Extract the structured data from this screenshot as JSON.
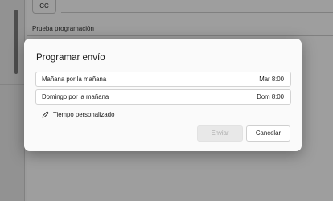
{
  "background": {
    "cc_label": "CC",
    "subject_text": "Prueba programación"
  },
  "dialog": {
    "title": "Programar envío",
    "options": [
      {
        "label": "Mañana por la mañana",
        "time": "Mar 8:00"
      },
      {
        "label": "Domingo por la mañana",
        "time": "Dom 8:00"
      }
    ],
    "custom_time_label": "Tiempo personalizado",
    "custom_time_icon": "pencil-icon",
    "send_label": "Enviar",
    "send_enabled": false,
    "cancel_label": "Cancelar"
  },
  "colors": {
    "overlay": "rgba(0,0,0,0.38)",
    "dialog_bg": "#fafafa",
    "disabled_text": "#a9a9a9"
  }
}
